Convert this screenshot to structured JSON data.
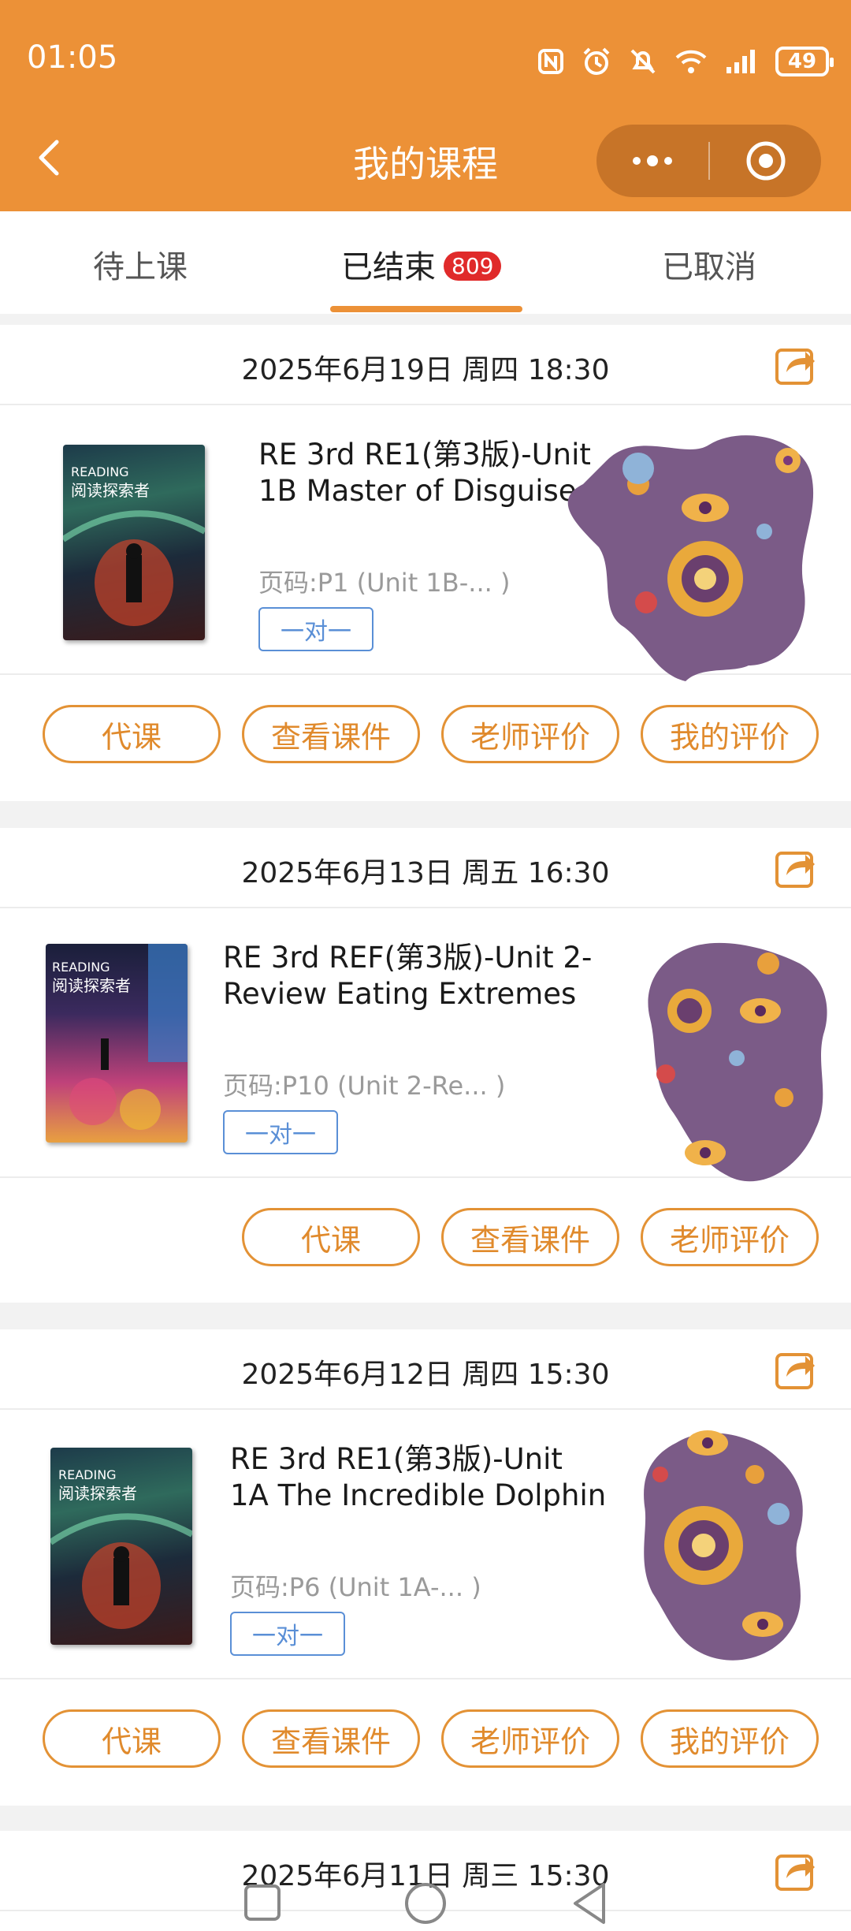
{
  "status_bar": {
    "time": "01:05",
    "battery": "49"
  },
  "header": {
    "title": "我的课程"
  },
  "tabs": [
    {
      "label": "待上课"
    },
    {
      "label": "已结束",
      "badge": "809"
    },
    {
      "label": "已取消"
    }
  ],
  "cards": [
    {
      "date": "2025年6月19日 周四 18:30",
      "title_line1": "RE 3rd RE1(第3版)-Unit",
      "title_line2": "1B Master of Disguise",
      "page": "页码:P1 (Unit 1B-... )",
      "tag": "一对一",
      "buttons": [
        "代课",
        "查看课件",
        "老师评价",
        "我的评价"
      ]
    },
    {
      "date": "2025年6月13日 周五 16:30",
      "title_line1": "RE 3rd REF(第3版)-Unit 2-",
      "title_line2": "Review Eating Extremes",
      "page": "页码:P10 (Unit 2-Re... )",
      "tag": "一对一",
      "buttons": [
        "代课",
        "查看课件",
        "老师评价"
      ]
    },
    {
      "date": "2025年6月12日 周四 15:30",
      "title_line1": "RE 3rd RE1(第3版)-Unit",
      "title_line2": "1A The Incredible Dolphin",
      "page": "页码:P6 (Unit 1A-...  )",
      "tag": "一对一",
      "buttons": [
        "代课",
        "查看课件",
        "老师评价",
        "我的评价"
      ]
    },
    {
      "date": "2025年6月11日 周三 15:30"
    }
  ],
  "colors": {
    "accent": "#ec9137",
    "badge": "#e02a2a",
    "tag": "#5a8fd6"
  }
}
